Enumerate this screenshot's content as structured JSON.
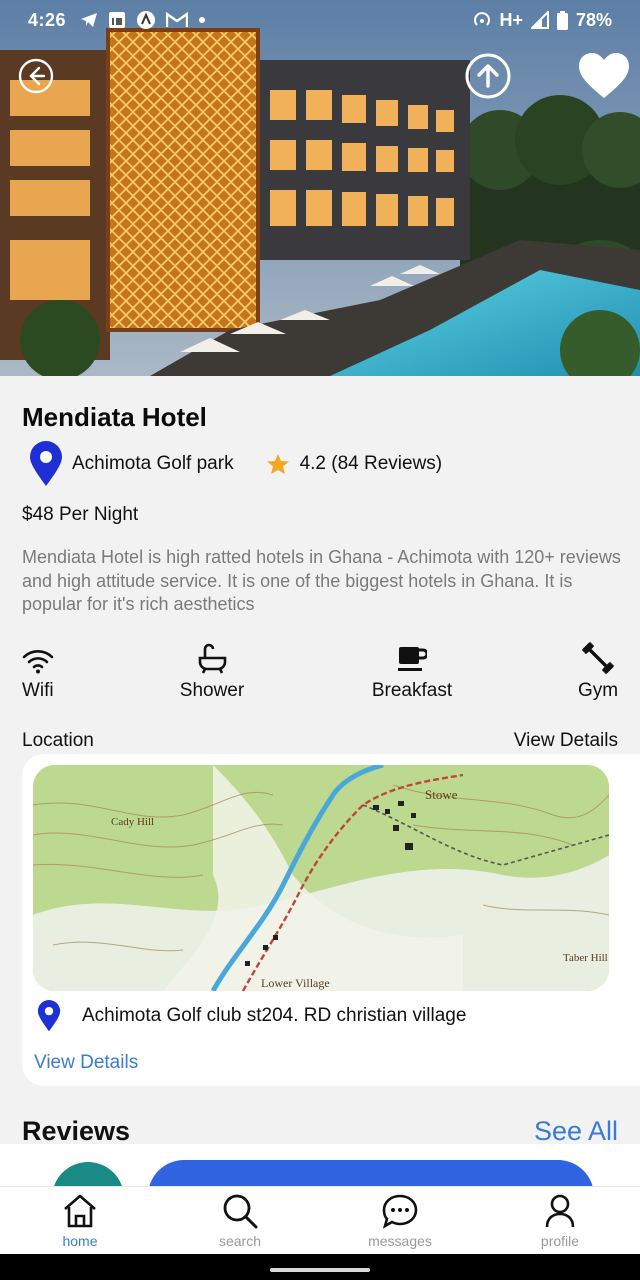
{
  "status_bar": {
    "time": "4:26",
    "network": "H+",
    "battery": "78%"
  },
  "hero": {
    "back_icon": "arrow-left-circle-icon",
    "share_icon": "arrow-up-circle-icon",
    "favorite_icon": "heart-icon"
  },
  "hotel": {
    "name": "Mendiata Hotel",
    "location": "Achimota Golf park",
    "rating": "4.2 (84 Reviews)",
    "price": "$48 Per Night",
    "description": "Mendiata Hotel is high ratted hotels in Ghana - Achimota with 120+ reviews and high attitude service. It is one of the biggest hotels in Ghana. It is popular for it's rich aesthetics"
  },
  "amenities": [
    {
      "label": "Wifi",
      "icon": "wifi-icon"
    },
    {
      "label": "Shower",
      "icon": "bathtub-icon"
    },
    {
      "label": "Breakfast",
      "icon": "coffee-cup-icon"
    },
    {
      "label": "Gym",
      "icon": "dumbbell-icon"
    }
  ],
  "location_section": {
    "title": "Location",
    "view_details": "View Details",
    "address": "Achimota Golf club st204. RD christian village",
    "card_view_details": "View Details",
    "map_labels": [
      "Cady Hill",
      "Stowe",
      "Lower Village",
      "Taber Hill"
    ]
  },
  "reviews": {
    "title": "Reviews",
    "see_all": "See All"
  },
  "nav": [
    {
      "label": "home",
      "icon": "home-icon"
    },
    {
      "label": "search",
      "icon": "search-icon"
    },
    {
      "label": "messages",
      "icon": "chat-bubble-icon"
    },
    {
      "label": "profile",
      "icon": "user-icon"
    }
  ],
  "colors": {
    "accent": "#3a7bd5",
    "pin": "#1f2fd6",
    "star": "#f5a623",
    "book_button": "#2f63e0",
    "circle_button": "#1a8a86"
  }
}
